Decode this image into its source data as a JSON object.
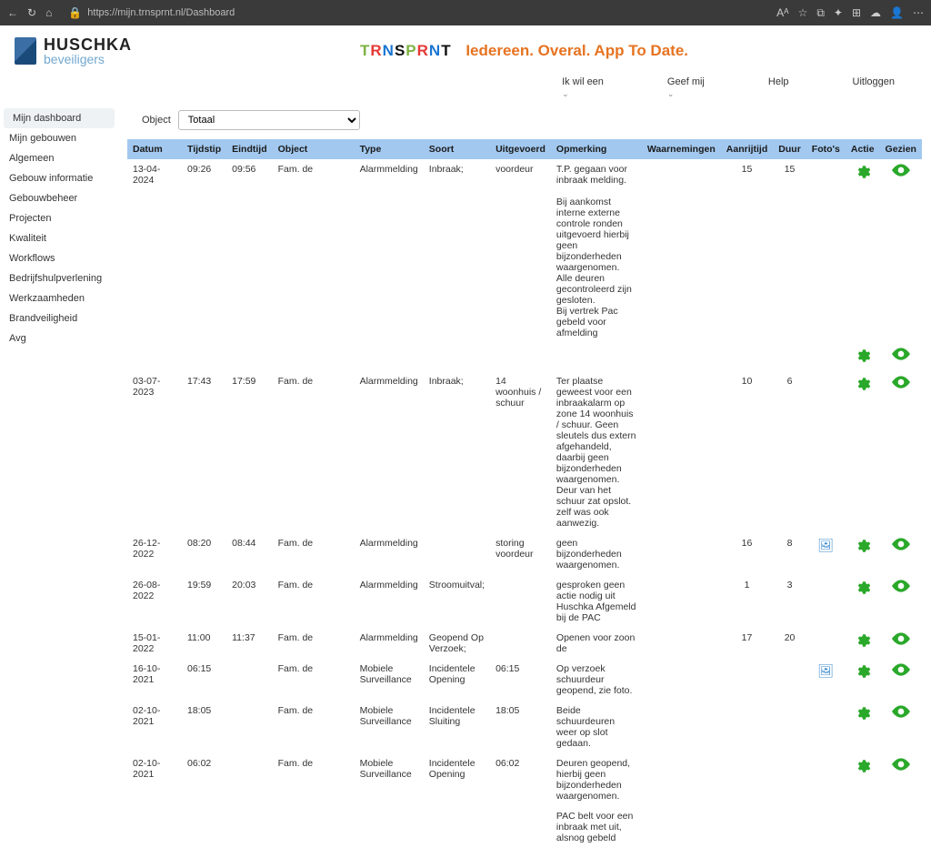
{
  "browser": {
    "url": "https://mijn.trnsprnt.nl/Dashboard",
    "url_prefix": "https://",
    "url_rest": "mijn.trnsprnt.nl/Dashboard"
  },
  "logo": {
    "line1": "HUSCHKA",
    "line2": "beveiligers"
  },
  "brand": {
    "letters": "TRNSPRNT",
    "tagline": "Iedereen. Overal. App To Date."
  },
  "topnav": {
    "ikwileen": "Ik wil een",
    "geefmij": "Geef mij",
    "help": "Help",
    "uitloggen": "Uitloggen"
  },
  "sidebar": {
    "items": [
      {
        "label": "Mijn dashboard",
        "active": true
      },
      {
        "label": "Mijn gebouwen"
      },
      {
        "label": "Algemeen"
      },
      {
        "label": "Gebouw informatie"
      },
      {
        "label": "Gebouwbeheer"
      },
      {
        "label": "Projecten"
      },
      {
        "label": "Kwaliteit"
      },
      {
        "label": "Workflows"
      },
      {
        "label": "Bedrijfshulpverlening"
      },
      {
        "label": "Werkzaamheden"
      },
      {
        "label": "Brandveiligheid"
      },
      {
        "label": "Avg"
      }
    ]
  },
  "filter": {
    "label": "Object",
    "selected": "Totaal"
  },
  "columns": {
    "datum": "Datum",
    "tijdstip": "Tijdstip",
    "eindtijd": "Eindtijd",
    "object": "Object",
    "type": "Type",
    "soort": "Soort",
    "uitgevoerd": "Uitgevoerd",
    "opmerking": "Opmerking",
    "waarnemingen": "Waarnemingen",
    "aanrijtijd": "Aanrijtijd",
    "duur": "Duur",
    "fotos": "Foto's",
    "actie": "Actie",
    "gezien": "Gezien"
  },
  "rows": [
    {
      "datum": "13-04-2024",
      "tijdstip": "09:26",
      "eindtijd": "09:56",
      "object": "Fam. de",
      "type": "Alarmmelding",
      "soort": "Inbraak;",
      "uitgevoerd": "voordeur",
      "opmerking": "T.P. gegaan voor inbraak melding.\n\nBij aankomst interne externe controle ronden uitgevoerd hierbij geen bijzonderheden waargenomen. Alle deuren gecontroleerd zijn gesloten.\nBij vertrek Pac gebeld voor afmelding",
      "waarnemingen": "",
      "aanrijtijd": "15",
      "duur": "15",
      "foto": false
    },
    {
      "datum": "03-07-2023",
      "tijdstip": "17:43",
      "eindtijd": "17:59",
      "object": "Fam. de",
      "type": "Alarmmelding",
      "soort": "Inbraak;",
      "uitgevoerd": "14 woonhuis / schuur",
      "opmerking": "Ter plaatse geweest voor een inbraakalarm op zone 14 woonhuis / schuur. Geen sleutels dus extern afgehandeld, daarbij geen bijzonderheden waargenomen. Deur van het schuur zat opslot. zelf was ook aanwezig.",
      "waarnemingen": "",
      "aanrijtijd": "10",
      "duur": "6",
      "foto": false
    },
    {
      "datum": "26-12-2022",
      "tijdstip": "08:20",
      "eindtijd": "08:44",
      "object": "Fam. de",
      "type": "Alarmmelding",
      "soort": "",
      "uitgevoerd": "storing voordeur",
      "opmerking": "geen bijzonderheden waargenomen.",
      "waarnemingen": "",
      "aanrijtijd": "16",
      "duur": "8",
      "foto": true
    },
    {
      "datum": "26-08-2022",
      "tijdstip": "19:59",
      "eindtijd": "20:03",
      "object": "Fam. de",
      "type": "Alarmmelding",
      "soort": "Stroomuitval;",
      "uitgevoerd": "",
      "opmerking": "gesproken geen actie nodig uit Huschka Afgemeld bij de PAC",
      "waarnemingen": "",
      "aanrijtijd": "1",
      "duur": "3",
      "foto": false
    },
    {
      "datum": "15-01-2022",
      "tijdstip": "11:00",
      "eindtijd": "11:37",
      "object": "Fam. de",
      "type": "Alarmmelding",
      "soort": "Geopend Op Verzoek;",
      "uitgevoerd": "",
      "opmerking": "Openen voor zoon de",
      "waarnemingen": "",
      "aanrijtijd": "17",
      "duur": "20",
      "foto": false
    },
    {
      "datum": "16-10-2021",
      "tijdstip": "06:15",
      "eindtijd": "",
      "object": "Fam. de",
      "type": "Mobiele Surveillance",
      "soort": "Incidentele Opening",
      "uitgevoerd": "06:15",
      "opmerking": "Op verzoek schuurdeur geopend, zie foto.",
      "waarnemingen": "",
      "aanrijtijd": "",
      "duur": "",
      "foto": true
    },
    {
      "datum": "02-10-2021",
      "tijdstip": "18:05",
      "eindtijd": "",
      "object": "Fam. de",
      "type": "Mobiele Surveillance",
      "soort": "Incidentele Sluiting",
      "uitgevoerd": "18:05",
      "opmerking": "Beide schuurdeuren weer op slot gedaan.",
      "waarnemingen": "",
      "aanrijtijd": "",
      "duur": "",
      "foto": false
    },
    {
      "datum": "02-10-2021",
      "tijdstip": "06:02",
      "eindtijd": "",
      "object": "Fam. de",
      "type": "Mobiele Surveillance",
      "soort": "Incidentele Opening",
      "uitgevoerd": "06:02",
      "opmerking": "Deuren geopend, hierbij geen bijzonderheden waargenomen.",
      "waarnemingen": "",
      "aanrijtijd": "",
      "duur": "",
      "foto": false
    }
  ],
  "trailing_text": "PAC belt voor een inbraak met uit, alsnog gebeld"
}
